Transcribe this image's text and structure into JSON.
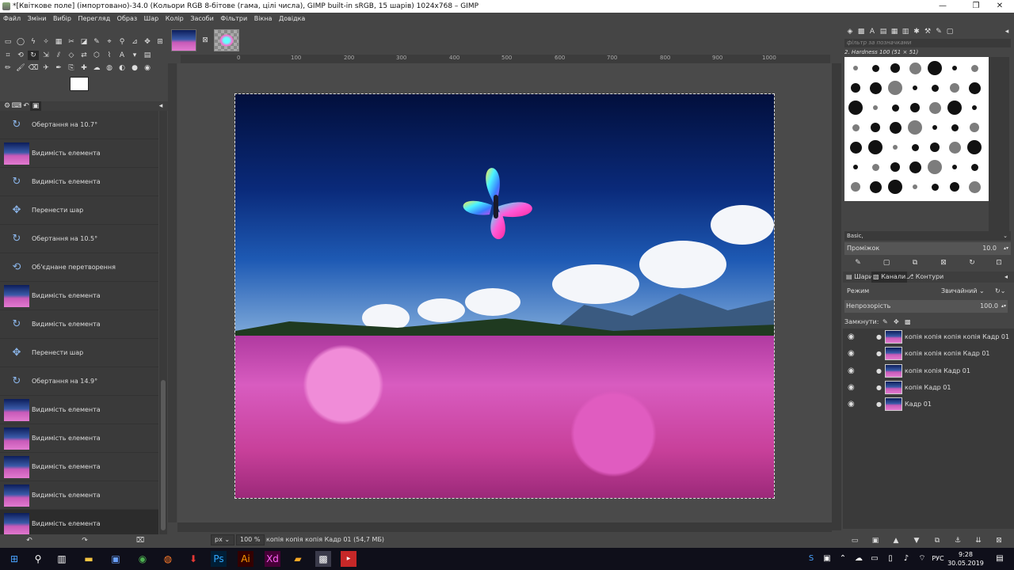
{
  "window": {
    "title": "*[Квіткове поле] (імпортовано)-34.0 (Кольори RGB 8-бітове (гама, цілі числа), GIMP built-in sRGB, 15 шарів) 1024x768 – GIMP"
  },
  "menubar": [
    "Файл",
    "Зміни",
    "Вибір",
    "Перегляд",
    "Образ",
    "Шар",
    "Колір",
    "Засоби",
    "Фільтри",
    "Вікна",
    "Довідка"
  ],
  "history": [
    {
      "label": "Обертання на 10.7°",
      "thumb": "rotate-icon"
    },
    {
      "label": "Видимість елемента",
      "thumb": "image"
    },
    {
      "label": "Видимість елемента",
      "thumb": "visibility-icon"
    },
    {
      "label": "Перенести шар",
      "thumb": "move-icon"
    },
    {
      "label": "Обертання на 10.5°",
      "thumb": "rotate-icon"
    },
    {
      "label": "Об'єднане перетворення",
      "thumb": "transform-icon"
    },
    {
      "label": "Видимість елемента",
      "thumb": "image"
    },
    {
      "label": "Видимість елемента",
      "thumb": "visibility-icon"
    },
    {
      "label": "Перенести шар",
      "thumb": "move-icon"
    },
    {
      "label": "Обертання на 14.9°",
      "thumb": "rotate-icon"
    },
    {
      "label": "Видимість елемента",
      "thumb": "image"
    },
    {
      "label": "Видимість елемента",
      "thumb": "image"
    },
    {
      "label": "Видимість елемента",
      "thumb": "image"
    },
    {
      "label": "Видимість елемента",
      "thumb": "image"
    },
    {
      "label": "Видимість елемента",
      "thumb": "image",
      "selected": true
    }
  ],
  "rulers": {
    "ticks": [
      "0",
      "100",
      "200",
      "300",
      "400",
      "500",
      "600",
      "700",
      "800",
      "900",
      "1000"
    ]
  },
  "statusbar": {
    "unit": "px",
    "zoom": "100 %",
    "info": "копія копія копія Кадр 01 (54,7 МБ)"
  },
  "brushes": {
    "filter_placeholder": "фільтр за позначками",
    "current": "2. Hardness 100 (51 × 51)",
    "preset": "Basic,",
    "spacing_label": "Проміжок",
    "spacing_value": "10.0"
  },
  "layers_panel": {
    "tabs": [
      "Шари",
      "Канали",
      "Контури"
    ],
    "mode_label": "Режим",
    "mode_value": "Звичайний",
    "opacity_label": "Непрозорість",
    "opacity_value": "100.0",
    "lock_label": "Замкнути:",
    "layers": [
      {
        "name": "копія копія копія копія Кадр 01"
      },
      {
        "name": "копія копія копія Кадр 01"
      },
      {
        "name": "копія копія Кадр 01"
      },
      {
        "name": "копія Кадр 01"
      },
      {
        "name": "Кадр 01"
      }
    ]
  },
  "taskbar": {
    "time": "9:28",
    "date": "30.05.2019",
    "lang": "РУС"
  }
}
